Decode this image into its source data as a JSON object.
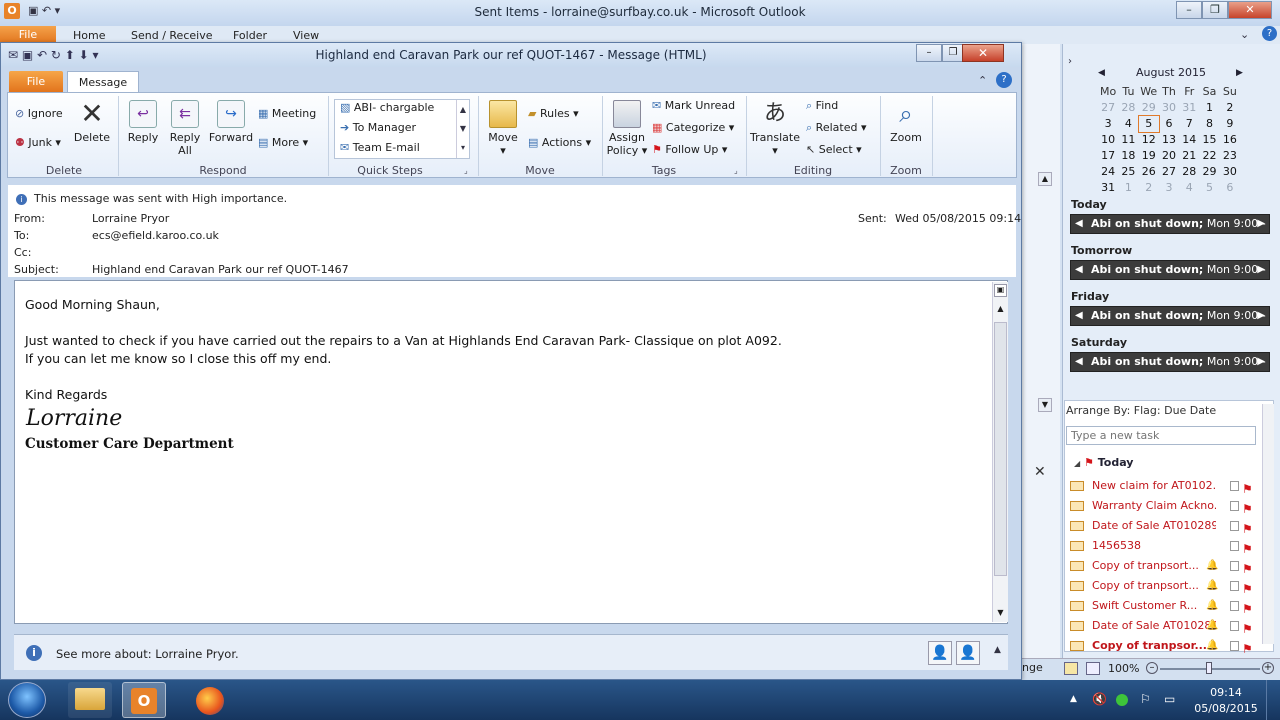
{
  "outlook": {
    "title": "Sent Items - lorraine@surfbay.co.uk  -  Microsoft Outlook",
    "tabs": [
      "File",
      "Home",
      "Send / Receive",
      "Folder",
      "View"
    ]
  },
  "message_window": {
    "title": "Highland end Caravan Park our ref QUOT-1467  -  Message (HTML)",
    "tabs": {
      "file": "File",
      "message": "Message"
    },
    "ribbon": {
      "delete_group": {
        "ignore": "Ignore",
        "junk": "Junk",
        "delete": "Delete",
        "label": "Delete"
      },
      "respond_group": {
        "reply": "Reply",
        "reply_all_1": "Reply",
        "reply_all_2": "All",
        "forward": "Forward",
        "meeting": "Meeting",
        "more": "More",
        "label": "Respond"
      },
      "quick_steps": {
        "items": [
          "ABI- chargable",
          "To Manager",
          "Team E-mail"
        ],
        "label": "Quick Steps"
      },
      "move_group": {
        "move": "Move",
        "rules": "Rules",
        "actions": "Actions",
        "label": "Move"
      },
      "tags_group": {
        "assign_1": "Assign",
        "assign_2": "Policy",
        "mark_unread": "Mark Unread",
        "categorize": "Categorize",
        "follow_up": "Follow Up",
        "label": "Tags"
      },
      "editing_group": {
        "translate": "Translate",
        "find": "Find",
        "related": "Related",
        "select": "Select",
        "label": "Editing"
      },
      "zoom_group": {
        "zoom": "Zoom",
        "label": "Zoom"
      }
    },
    "header": {
      "importance": "This message was sent with High importance.",
      "from_label": "From:",
      "from": "Lorraine Pryor",
      "to_label": "To:",
      "to": "ecs@efield.karoo.co.uk",
      "cc_label": "Cc:",
      "subject_label": "Subject:",
      "subject": "Highland end Caravan Park our ref QUOT-1467",
      "sent_label": "Sent:",
      "sent": "Wed 05/08/2015 09:14"
    },
    "body": {
      "greeting": "Good Morning Shaun,",
      "line1": "Just wanted to check if you have carried out the repairs to a Van at Highlands End Caravan Park- Classique on plot A092.",
      "line2": "If you can let me know so I close this off my end.",
      "closing": "Kind Regards",
      "signature_name": "Lorraine",
      "signature_dept": "Customer Care Department"
    },
    "people_pane": {
      "text": "See more about: Lorraine Pryor."
    }
  },
  "todo_bar": {
    "calendar": {
      "month": "August 2015",
      "weekdays": [
        "Mo",
        "Tu",
        "We",
        "Th",
        "Fr",
        "Sa",
        "Su"
      ],
      "weeks": [
        [
          "27",
          "28",
          "29",
          "30",
          "31",
          "1",
          "2"
        ],
        [
          "3",
          "4",
          "5",
          "6",
          "7",
          "8",
          "9"
        ],
        [
          "10",
          "11",
          "12",
          "13",
          "14",
          "15",
          "16"
        ],
        [
          "17",
          "18",
          "19",
          "20",
          "21",
          "22",
          "23"
        ],
        [
          "24",
          "25",
          "26",
          "27",
          "28",
          "29",
          "30"
        ],
        [
          "31",
          "1",
          "2",
          "3",
          "4",
          "5",
          "6"
        ]
      ]
    },
    "days": [
      {
        "label": "Today",
        "appt_bold": "Abi on shut down;",
        "appt_rest": " Mon 9:00 -"
      },
      {
        "label": "Tomorrow",
        "appt_bold": "Abi on shut down;",
        "appt_rest": " Mon 9:00 -"
      },
      {
        "label": "Friday",
        "appt_bold": "Abi on shut down;",
        "appt_rest": " Mon 9:00 -"
      },
      {
        "label": "Saturday",
        "appt_bold": "Abi on shut down;",
        "appt_rest": " Mon 9:00 -"
      }
    ],
    "tasks": {
      "arrange_by": "Arrange By: Flag: Due Date",
      "new_task_placeholder": "Type a new task",
      "group": "Today",
      "items": [
        "New claim for AT0102...",
        "Warranty Claim Ackno...",
        "Date of Sale AT010289...",
        "1456538",
        "Copy of tranpsort...",
        "Copy of tranpsort...",
        "Swift Customer R...",
        "Date of Sale AT010289...",
        "Copy of tranpsor..."
      ]
    }
  },
  "status_bar": {
    "zoom": "100%",
    "partial_left": "nge"
  },
  "taskbar": {
    "time": "09:14",
    "date": "05/08/2015"
  },
  "colors": {
    "file_tab": "#e2741c",
    "flag": "#d4141a",
    "task_text": "#c0161b"
  }
}
